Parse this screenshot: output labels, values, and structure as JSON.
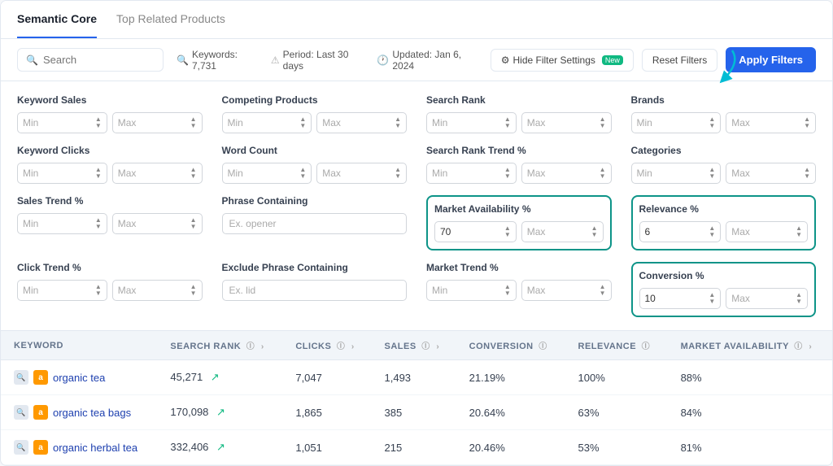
{
  "tabs": [
    {
      "id": "semantic-core",
      "label": "Semantic Core",
      "active": true
    },
    {
      "id": "top-related",
      "label": "Top Related Products",
      "active": false
    }
  ],
  "toolbar": {
    "search_placeholder": "Search",
    "keywords_count": "Keywords: 7,731",
    "period": "Period: Last 30 days",
    "updated": "Updated: Jan 6, 2024",
    "hide_filter_label": "Hide Filter Settings",
    "new_badge": "New",
    "reset_label": "Reset Filters",
    "apply_label": "Apply Filters"
  },
  "filters": {
    "rows": [
      [
        {
          "id": "keyword-sales",
          "label": "Keyword Sales",
          "type": "minmax",
          "min_val": "",
          "max_val": "",
          "min_ph": "Min",
          "max_ph": "Max",
          "highlighted": false
        },
        {
          "id": "competing-products",
          "label": "Competing Products",
          "type": "minmax",
          "min_val": "",
          "max_val": "",
          "min_ph": "Min",
          "max_ph": "Max",
          "highlighted": false
        },
        {
          "id": "search-rank",
          "label": "Search Rank",
          "type": "minmax",
          "min_val": "",
          "max_val": "",
          "min_ph": "Min",
          "max_ph": "Max",
          "highlighted": false
        },
        {
          "id": "brands",
          "label": "Brands",
          "type": "minmax",
          "min_val": "",
          "max_val": "",
          "min_ph": "Min",
          "max_ph": "Max",
          "highlighted": false
        }
      ],
      [
        {
          "id": "keyword-clicks",
          "label": "Keyword Clicks",
          "type": "minmax",
          "min_val": "",
          "max_val": "",
          "min_ph": "Min",
          "max_ph": "Max",
          "highlighted": false
        },
        {
          "id": "word-count",
          "label": "Word Count",
          "type": "minmax",
          "min_val": "",
          "max_val": "",
          "min_ph": "Min",
          "max_ph": "Max",
          "highlighted": false
        },
        {
          "id": "search-rank-trend",
          "label": "Search Rank Trend %",
          "type": "minmax",
          "min_val": "",
          "max_val": "",
          "min_ph": "Min",
          "max_ph": "Max",
          "highlighted": false
        },
        {
          "id": "categories",
          "label": "Categories",
          "type": "minmax",
          "min_val": "",
          "max_val": "",
          "min_ph": "Min",
          "max_ph": "Max",
          "highlighted": false
        }
      ],
      [
        {
          "id": "sales-trend",
          "label": "Sales Trend %",
          "type": "minmax",
          "min_val": "",
          "max_val": "",
          "min_ph": "Min",
          "max_ph": "Max",
          "highlighted": false
        },
        {
          "id": "phrase-containing",
          "label": "Phrase Containing",
          "type": "select",
          "placeholder": "Ex. opener",
          "highlighted": false
        },
        {
          "id": "market-availability",
          "label": "Market Availability %",
          "type": "minmax",
          "min_val": "70",
          "max_val": "",
          "min_ph": "Min",
          "max_ph": "Max",
          "highlighted": true
        },
        {
          "id": "relevance",
          "label": "Relevance %",
          "type": "minmax",
          "min_val": "6",
          "max_val": "",
          "min_ph": "Min",
          "max_ph": "Max",
          "highlighted": true
        }
      ],
      [
        {
          "id": "click-trend",
          "label": "Click Trend %",
          "type": "minmax",
          "min_val": "",
          "max_val": "",
          "min_ph": "Min",
          "max_ph": "Max",
          "highlighted": false
        },
        {
          "id": "exclude-phrase",
          "label": "Exclude Phrase Containing",
          "type": "select",
          "placeholder": "Ex. lid",
          "highlighted": false
        },
        {
          "id": "market-trend",
          "label": "Market Trend %",
          "type": "minmax",
          "min_val": "",
          "max_val": "",
          "min_ph": "Min",
          "max_ph": "Max",
          "highlighted": false
        },
        {
          "id": "conversion",
          "label": "Conversion %",
          "type": "minmax",
          "min_val": "10",
          "max_val": "",
          "min_ph": "Min",
          "max_ph": "Max",
          "highlighted": true
        }
      ]
    ]
  },
  "table": {
    "columns": [
      {
        "id": "keyword",
        "label": "KEYWORD",
        "sortable": false
      },
      {
        "id": "search-rank",
        "label": "SEARCH RANK",
        "sortable": true
      },
      {
        "id": "clicks",
        "label": "CLICKS",
        "sortable": true
      },
      {
        "id": "sales",
        "label": "SALES",
        "sortable": true
      },
      {
        "id": "conversion",
        "label": "CONVERSION",
        "sortable": false,
        "info": true
      },
      {
        "id": "relevance",
        "label": "RELEVANCE",
        "sortable": false,
        "info": true
      },
      {
        "id": "market-availability",
        "label": "MARKET AVAILABILITY",
        "sortable": false,
        "info": true
      }
    ],
    "rows": [
      {
        "keyword": "organic tea",
        "search_rank": "45,271",
        "clicks": "7,047",
        "sales": "1,493",
        "conversion": "21.19%",
        "relevance": "100%",
        "market_availability": "88%",
        "trend": "up"
      },
      {
        "keyword": "organic tea bags",
        "search_rank": "170,098",
        "clicks": "1,865",
        "sales": "385",
        "conversion": "20.64%",
        "relevance": "63%",
        "market_availability": "84%",
        "trend": "up"
      },
      {
        "keyword": "organic herbal tea",
        "search_rank": "332,406",
        "clicks": "1,051",
        "sales": "215",
        "conversion": "20.46%",
        "relevance": "53%",
        "market_availability": "81%",
        "trend": "up"
      }
    ]
  },
  "icons": {
    "search": "🔍",
    "keywords": "🔍",
    "period": "⚠",
    "updated": "🕐",
    "hide_filter": "⚙",
    "sort_asc": "›",
    "trend_up": "↗",
    "info": "ⓘ",
    "amazon": "a",
    "shop": "🔍"
  }
}
